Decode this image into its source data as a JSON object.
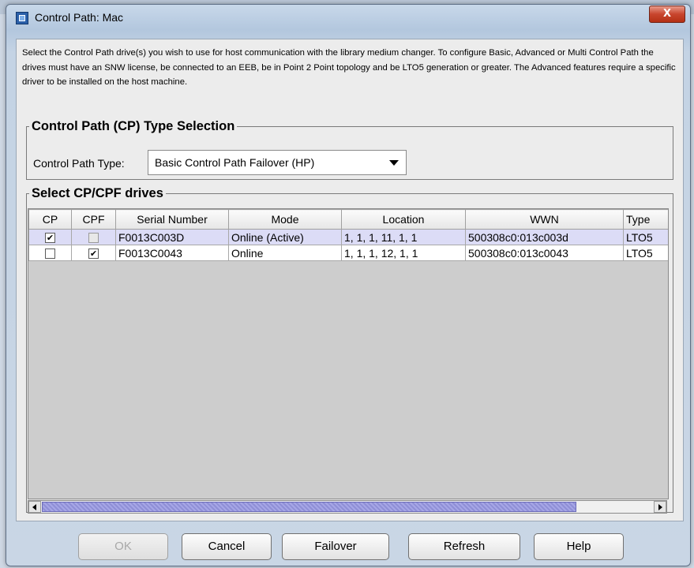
{
  "window": {
    "title": "Control Path: Mac",
    "close_label": "X"
  },
  "description": "Select the Control Path drive(s) you wish to use for host communication with the library medium changer. To configure Basic, Advanced or Multi Control Path the drives must have an SNW license, be connected to an EEB, be in Point 2 Point topology and be LTO5 generation or greater. The Advanced features require a specific driver to be installed on the host machine.",
  "cp_type_group": {
    "legend": "Control Path (CP) Type Selection",
    "label": "Control Path Type:",
    "selected": "Basic Control Path Failover (HP)"
  },
  "drives_group": {
    "legend": "Select CP/CPF drives",
    "columns": [
      "CP",
      "CPF",
      "Serial Number",
      "Mode",
      "Location",
      "WWN",
      "Type"
    ],
    "rows": [
      {
        "cp": true,
        "cpf": false,
        "cpf_disabled": true,
        "serial": "F0013C003D",
        "mode": "Online (Active)",
        "location": "1, 1, 1, 11, 1, 1",
        "wwn": "500308c0:013c003d",
        "type": "LTO5",
        "selected": true
      },
      {
        "cp": false,
        "cpf": true,
        "cpf_disabled": false,
        "serial": "F0013C0043",
        "mode": "Online",
        "location": "1, 1, 1, 12, 1, 1",
        "wwn": "500308c0:013c0043",
        "type": "LTO5",
        "selected": false
      }
    ]
  },
  "buttons": {
    "ok": "OK",
    "cancel": "Cancel",
    "failover": "Failover",
    "refresh": "Refresh",
    "help": "Help"
  },
  "check_glyph": "✔"
}
